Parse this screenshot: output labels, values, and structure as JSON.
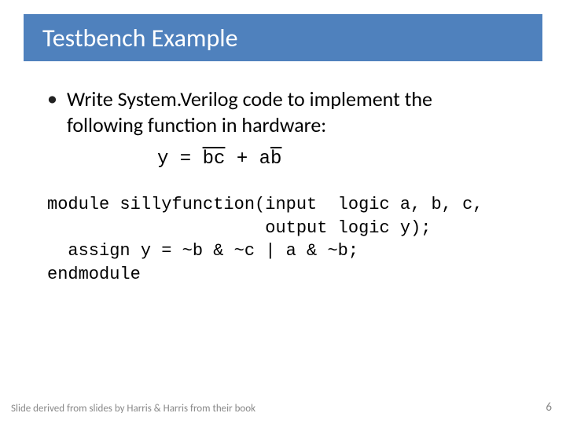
{
  "title": "Testbench Example",
  "bullet": {
    "line1": "Write System.Verilog code to implement the",
    "line2": "following function in hardware:"
  },
  "equation": {
    "lhs": "y = ",
    "term1": "bc",
    "plus": " + ",
    "term2_plain": "a",
    "term2_bar": "b"
  },
  "code": {
    "l1": "module sillyfunction(input  logic a, b, c,",
    "l2": "                     output logic y);",
    "l3": "  assign y = ~b & ~c | a & ~b;",
    "l4": "endmodule"
  },
  "footer": {
    "attribution": "Slide derived from slides by Harris & Harris from their book",
    "page": "6"
  }
}
